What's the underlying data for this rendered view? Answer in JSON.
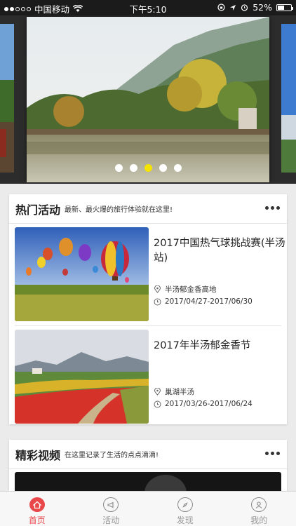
{
  "status_bar": {
    "carrier": "中国移动",
    "time": "下午5:10",
    "battery": "52%",
    "battery_level": 0.52
  },
  "carousel": {
    "slide_count": 5,
    "active_index": 2
  },
  "hot_events": {
    "title": "热门活动",
    "subtitle": "最新、最火爆的旅行体验就在这里!",
    "items": [
      {
        "title": "2017中国热气球挑战赛(半汤站)",
        "location": "半汤郁金香高地",
        "date": "2017/04/27-2017/06/30"
      },
      {
        "title": "2017年半汤郁金香节",
        "location": "巢湖半汤",
        "date": "2017/03/26-2017/06/24"
      }
    ]
  },
  "videos": {
    "title": "精彩视频",
    "subtitle": "在这里记录了生活的点点滴滴!"
  },
  "tab_bar": {
    "items": [
      {
        "label": "首页",
        "icon": "home-icon",
        "active": true
      },
      {
        "label": "活动",
        "icon": "megaphone-icon",
        "active": false
      },
      {
        "label": "发现",
        "icon": "compass-icon",
        "active": false
      },
      {
        "label": "我的",
        "icon": "user-icon",
        "active": false
      }
    ]
  },
  "colors": {
    "accent": "#e9484a",
    "indicator_active": "#f5e300"
  }
}
